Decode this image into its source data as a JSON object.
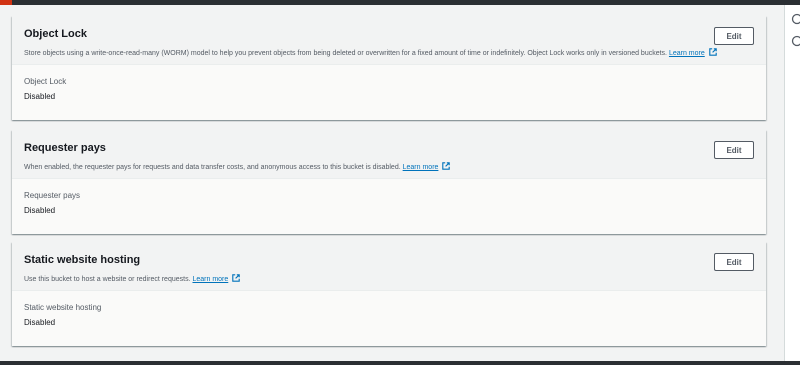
{
  "panels": [
    {
      "title": "Object Lock",
      "description": "Store objects using a write-once-read-many (WORM) model to help you prevent objects from being deleted or overwritten for a fixed amount of time or indefinitely. Object Lock works only in versioned buckets.",
      "link_label": "Learn more",
      "edit_label": "Edit",
      "field_label": "Object Lock",
      "field_value": "Disabled"
    },
    {
      "title": "Requester pays",
      "description": "When enabled, the requester pays for requests and data transfer costs, and anonymous access to this bucket is disabled.",
      "link_label": "Learn more",
      "edit_label": "Edit",
      "field_label": "Requester pays",
      "field_value": "Disabled"
    },
    {
      "title": "Static website hosting",
      "description": "Use this bucket to host a website or redirect requests.",
      "link_label": "Learn more",
      "edit_label": "Edit",
      "field_label": "Static website hosting",
      "field_value": "Disabled"
    }
  ],
  "icons": {
    "external_link": "external-link-icon",
    "side_panel_1": "info-icon",
    "side_panel_2": "gear-icon"
  },
  "colors": {
    "link": "#0073bb",
    "accent_red": "#d13212",
    "top_bar": "#2b2f33"
  }
}
